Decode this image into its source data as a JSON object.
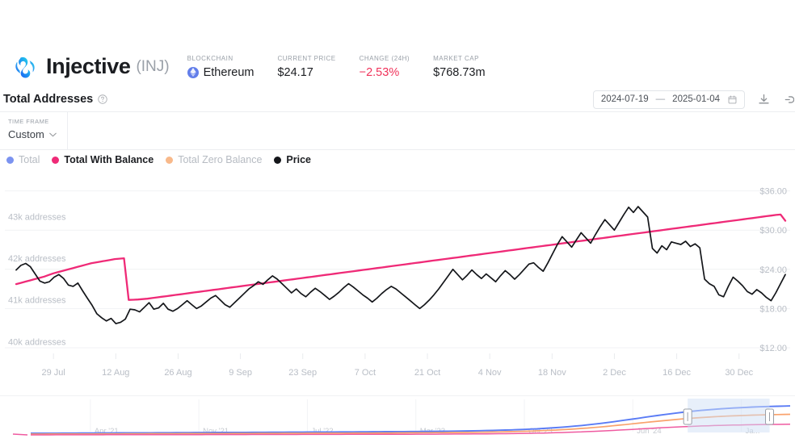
{
  "asset": {
    "name": "Injective",
    "ticker": "(INJ)",
    "logo_icon": "injective-logo-icon",
    "stats": [
      {
        "label": "BLOCKCHAIN",
        "value": "Ethereum",
        "icon": "ethereum-icon",
        "negative": false
      },
      {
        "label": "CURRENT PRICE",
        "value": "$24.17",
        "icon": "",
        "negative": false
      },
      {
        "label": "CHANGE (24H)",
        "value": "−2.53%",
        "icon": "",
        "negative": true
      },
      {
        "label": "MARKET CAP",
        "value": "$768.73m",
        "icon": "",
        "negative": false
      }
    ]
  },
  "metric": {
    "title": "Total Addresses",
    "help_icon": "question-circle-icon",
    "date_from": "2024-07-19",
    "date_separator": "—",
    "date_to": "2025-01-04",
    "calendar_icon": "calendar-icon",
    "download_icon": "download-icon",
    "embed_icon": "link-icon"
  },
  "time_frame": {
    "label": "TIME FRAME",
    "value": "Custom",
    "chevron_icon": "chevron-down-icon"
  },
  "legend": [
    {
      "label": "Total",
      "color": "#7b93f0",
      "active": false
    },
    {
      "label": "Total With Balance",
      "color": "#ef2a77",
      "active": true
    },
    {
      "label": "Total Zero Balance",
      "color": "#f8b98a",
      "active": false
    },
    {
      "label": "Price",
      "color": "#14161a",
      "active": true
    }
  ],
  "chart_data": {
    "type": "line",
    "title": "Total Addresses",
    "xlabel": "",
    "ylabel": "addresses",
    "y2label": "Price",
    "grid": true,
    "legend_position": "top-left",
    "x_ticks": [
      "29 Jul",
      "12 Aug",
      "26 Aug",
      "9 Sep",
      "23 Sep",
      "7 Oct",
      "21 Oct",
      "4 Nov",
      "18 Nov",
      "2 Dec",
      "16 Dec",
      "30 Dec"
    ],
    "y_left_ticks": [
      "43k addresses",
      "42k addresses",
      "41k addresses",
      "40k addresses"
    ],
    "y_left_values": [
      43000,
      42000,
      41000,
      40000
    ],
    "ylim": [
      39600,
      43900
    ],
    "y_right_ticks": [
      "$36.00",
      "$30.00",
      "$24.00",
      "$18.00",
      "$12.00"
    ],
    "y_right_values": [
      36,
      30,
      24,
      18,
      12
    ],
    "y2lim": [
      10.4,
      37.8
    ],
    "series": [
      {
        "name": "Total With Balance",
        "color": "#ef2a77",
        "axis": "left",
        "values": [
          41380,
          41410,
          41440,
          41470,
          41500,
          41530,
          41560,
          41600,
          41640,
          41670,
          41700,
          41730,
          41760,
          41790,
          41820,
          41850,
          41880,
          41900,
          41920,
          41940,
          41960,
          41980,
          41990,
          42000,
          41000,
          41005,
          41010,
          41020,
          41030,
          41045,
          41060,
          41075,
          41090,
          41105,
          41120,
          41135,
          41150,
          41165,
          41180,
          41195,
          41210,
          41225,
          41240,
          41255,
          41270,
          41285,
          41300,
          41315,
          41330,
          41345,
          41360,
          41375,
          41390,
          41405,
          41420,
          41435,
          41450,
          41465,
          41480,
          41495,
          41510,
          41525,
          41540,
          41555,
          41570,
          41585,
          41600,
          41615,
          41630,
          41645,
          41660,
          41675,
          41690,
          41705,
          41720,
          41735,
          41750,
          41765,
          41780,
          41795,
          41810,
          41825,
          41840,
          41855,
          41870,
          41885,
          41900,
          41915,
          41930,
          41945,
          41960,
          41975,
          41990,
          42005,
          42020,
          42035,
          42050,
          42065,
          42080,
          42095,
          42110,
          42125,
          42140,
          42155,
          42170,
          42185,
          42200,
          42215,
          42230,
          42245,
          42260,
          42275,
          42290,
          42305,
          42320,
          42335,
          42350,
          42365,
          42380,
          42395,
          42410,
          42425,
          42440,
          42455,
          42470,
          42485,
          42500,
          42515,
          42530,
          42545,
          42560,
          42575,
          42590,
          42605,
          42620,
          42635,
          42650,
          42665,
          42680,
          42695,
          42710,
          42725,
          42740,
          42755,
          42770,
          42785,
          42800,
          42815,
          42830,
          42845,
          42860,
          42875,
          42890,
          42905,
          42920,
          42935,
          42950,
          42965,
          42980,
          42995,
          43010,
          43025,
          43040,
          43050,
          42900
        ]
      },
      {
        "name": "Price",
        "color": "#14161a",
        "axis": "right",
        "values": [
          23.9,
          24.6,
          24.9,
          24.4,
          23.3,
          22.2,
          21.9,
          22.1,
          22.8,
          23.2,
          22.6,
          21.6,
          21.4,
          21.9,
          20.7,
          19.6,
          18.5,
          17.2,
          16.6,
          16.1,
          16.5,
          15.7,
          15.9,
          16.4,
          17.9,
          17.8,
          17.5,
          18.2,
          18.9,
          17.9,
          18.1,
          18.8,
          17.9,
          17.6,
          18.0,
          18.6,
          19.2,
          18.6,
          18.0,
          18.4,
          19.0,
          19.6,
          20.0,
          19.3,
          18.6,
          18.2,
          18.9,
          19.6,
          20.3,
          21.0,
          21.5,
          22.1,
          21.7,
          22.4,
          23.0,
          22.5,
          21.8,
          21.1,
          20.4,
          21.0,
          20.3,
          19.8,
          20.5,
          21.1,
          20.6,
          20.0,
          19.4,
          19.9,
          20.5,
          21.2,
          21.8,
          21.3,
          20.7,
          20.1,
          19.6,
          19.0,
          19.6,
          20.3,
          20.9,
          21.4,
          21.0,
          20.4,
          19.8,
          19.2,
          18.6,
          18.0,
          18.6,
          19.3,
          20.1,
          21.0,
          22.0,
          23.0,
          24.0,
          23.2,
          22.4,
          23.1,
          23.9,
          23.2,
          22.6,
          23.3,
          22.7,
          22.1,
          23.0,
          23.8,
          23.2,
          22.5,
          23.2,
          24.0,
          24.8,
          25.0,
          24.3,
          23.7,
          25.0,
          26.4,
          27.8,
          29.0,
          28.2,
          27.4,
          28.5,
          29.6,
          28.8,
          28.0,
          29.3,
          30.5,
          31.6,
          30.8,
          30.0,
          31.2,
          32.4,
          33.5,
          32.7,
          33.6,
          32.8,
          32.0,
          27.2,
          26.5,
          27.6,
          27.0,
          28.2,
          28.0,
          27.8,
          28.3,
          27.5,
          27.9,
          27.3,
          22.5,
          21.8,
          21.4,
          20.1,
          19.8,
          21.4,
          22.8,
          22.2,
          21.5,
          20.6,
          20.2,
          20.9,
          20.4,
          19.7,
          19.2,
          20.4,
          21.8,
          23.2
        ]
      }
    ]
  },
  "navigator": {
    "x_labels": [
      "Apr '21",
      "Nov '21",
      "Jul '22",
      "Mar '23",
      "Oct '23",
      "Jun '24",
      "Ja..."
    ],
    "selection": {
      "start_pct": 86.5,
      "end_pct": 96.8
    },
    "handle_icon": "range-handle-icon",
    "series": [
      {
        "name": "Total",
        "color": "#5b7cf5"
      },
      {
        "name": "Total Zero Balance",
        "color": "#f9a26c"
      },
      {
        "name": "Total With Balance",
        "color": "#ef5aa0"
      }
    ]
  }
}
